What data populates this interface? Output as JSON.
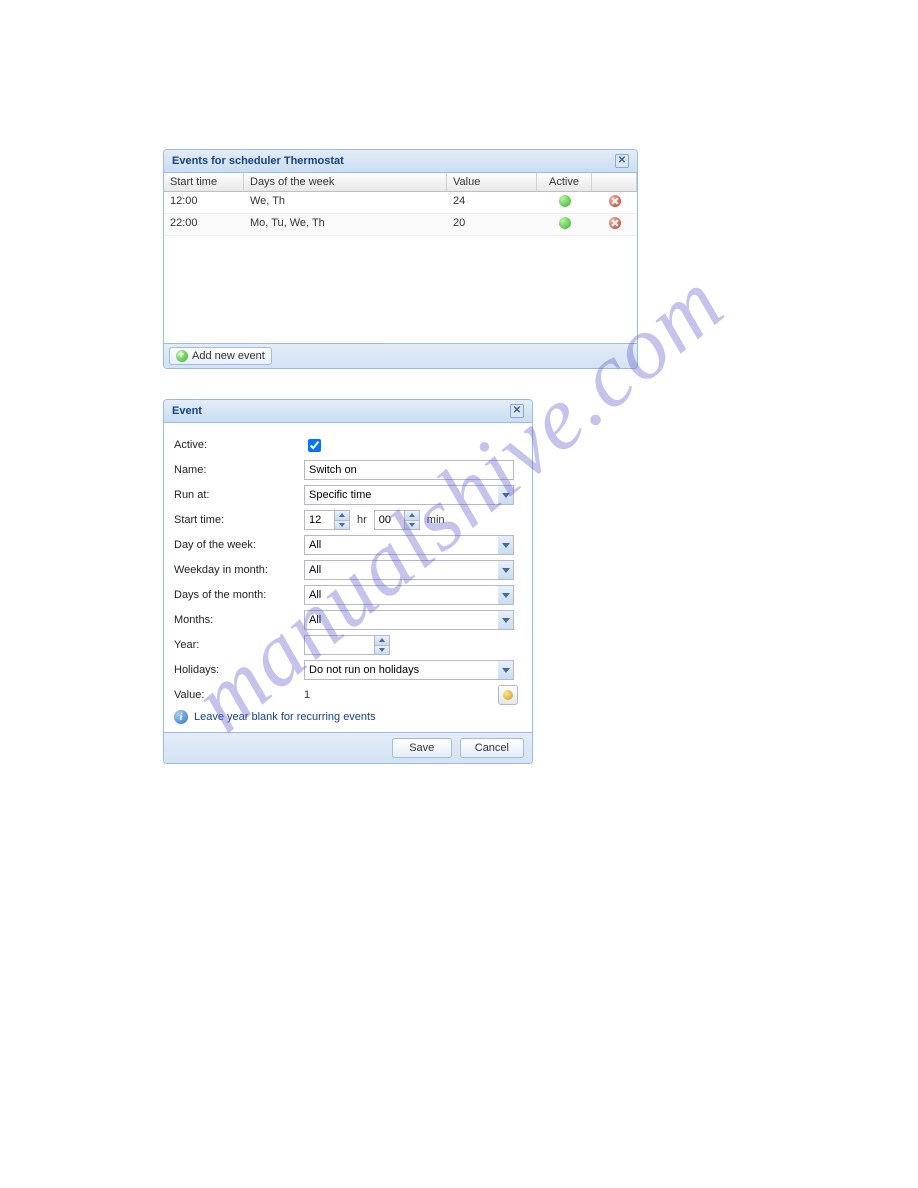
{
  "watermark": "manualshive.com",
  "events_panel": {
    "title": "Events for scheduler Thermostat",
    "columns": {
      "start_time": "Start time",
      "days": "Days of the week",
      "value": "Value",
      "active": "Active"
    },
    "rows": [
      {
        "start_time": "12:00",
        "days": "We, Th",
        "value": "24"
      },
      {
        "start_time": "22:00",
        "days": "Mo, Tu, We, Th",
        "value": "20"
      }
    ],
    "add_button": "Add new event"
  },
  "event_form": {
    "title": "Event",
    "labels": {
      "active": "Active:",
      "name": "Name:",
      "run_at": "Run at:",
      "start_time": "Start time:",
      "day_of_week": "Day of the week:",
      "weekday_in_month": "Weekday in month:",
      "days_of_month": "Days of the month:",
      "months": "Months:",
      "year": "Year:",
      "holidays": "Holidays:",
      "value": "Value:"
    },
    "values": {
      "active_checked": true,
      "name": "Switch on",
      "run_at": "Specific time",
      "start_hr": "12",
      "start_min": "00",
      "hr_label": "hr",
      "min_label": "min",
      "day_of_week": "All",
      "weekday_in_month": "All",
      "days_of_month": "All",
      "months": "All",
      "year": "",
      "holidays": "Do not run on holidays",
      "value": "1"
    },
    "info_note": "Leave year blank for recurring events",
    "buttons": {
      "save": "Save",
      "cancel": "Cancel"
    }
  }
}
